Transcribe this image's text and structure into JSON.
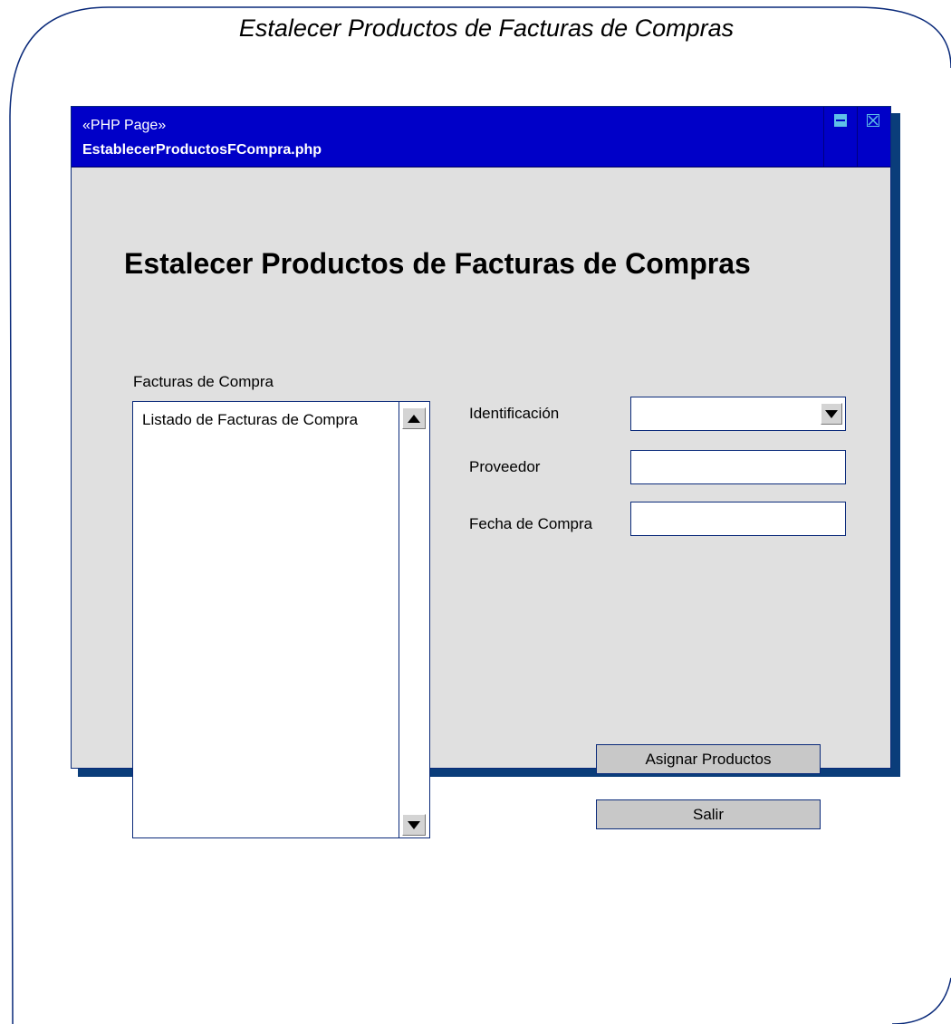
{
  "diagram": {
    "title": "Estalecer Productos de Facturas de Compras"
  },
  "window": {
    "stereotype": "«PHP Page»",
    "filename": "EstablecerProductosFCompra.php",
    "controls": [
      "maximize-icon",
      "close-icon"
    ],
    "titlebar_color": "#0000c8"
  },
  "page": {
    "heading": "Estalecer Productos de Facturas de Compras"
  },
  "invoices": {
    "label": "Facturas de Compra",
    "items": [
      "Listado de Facturas de Compra"
    ]
  },
  "form": {
    "identificacion_label": "Identificación",
    "identificacion_value": "",
    "proveedor_label": "Proveedor",
    "proveedor_value": "",
    "fecha_label": "Fecha de Compra",
    "fecha_value": ""
  },
  "actions": {
    "assign_label": "Asignar Productos",
    "exit_label": "Salir"
  }
}
